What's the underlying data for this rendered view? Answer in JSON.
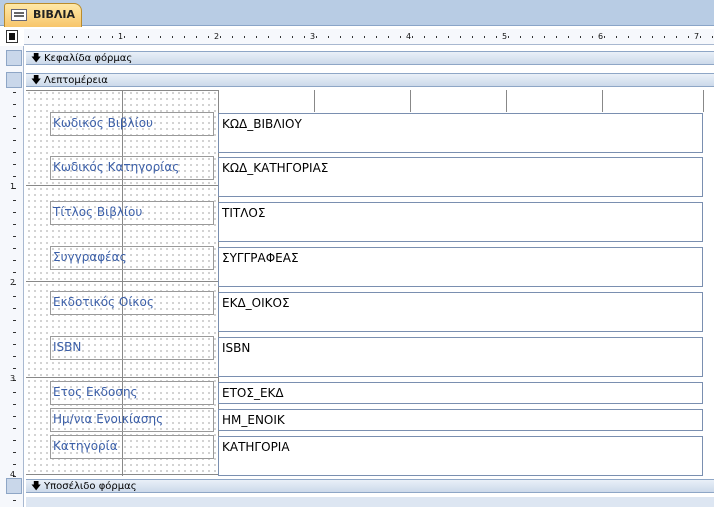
{
  "tab": {
    "title": "ΒΙΒΛΙΑ",
    "icon": "form-icon"
  },
  "ruler": {
    "h_labels": [
      "1",
      "2",
      "3",
      "4",
      "5",
      "6",
      "7"
    ],
    "v_labels": [
      "1",
      "2",
      "3",
      "4"
    ]
  },
  "sections": {
    "header": "Κεφαλίδα φόρμας",
    "detail": "Λεπτομέρεια",
    "footer": "Υποσέλιδο φόρμας"
  },
  "fields": [
    {
      "label": "Κωδικός Βιβλίου",
      "control": "ΚΩΔ_ΒΙΒΛΙΟΥ"
    },
    {
      "label": "Κωδικός Κατηγορίας",
      "control": "ΚΩΔ_ΚΑΤΗΓΟΡΙΑΣ"
    },
    {
      "label": "Τίτλος Βιβλίου",
      "control": "ΤΙΤΛΟΣ"
    },
    {
      "label": "Συγγραφέας",
      "control": "ΣΥΓΓΡΑΦΕΑΣ"
    },
    {
      "label": "Εκδοτικός Οίκος",
      "control": "ΕΚΔ_ΟΙΚΟΣ"
    },
    {
      "label": "ISBN",
      "control": "ISBN"
    },
    {
      "label": "Ετος Εκδοσης",
      "control": "ΕΤΟΣ_ΕΚΔ"
    },
    {
      "label": "Ημ/νια Ενοικίασης",
      "control": "ΗΜ_ΕΝΟΙΚ"
    },
    {
      "label": "Κατηγορία",
      "control": "ΚΑΤΗΓΟΡΙΑ"
    }
  ],
  "colors": {
    "label_text": "#3b5fa8",
    "section_bar": "#ccd9ea",
    "tab": "#f7c56a"
  }
}
